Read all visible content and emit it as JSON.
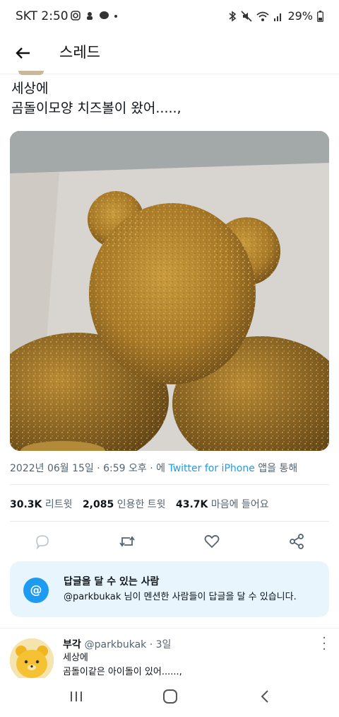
{
  "status_bar": {
    "carrier_time": "SKT 2:50",
    "battery": "29%"
  },
  "app_bar": {
    "title": "스레드"
  },
  "tweet": {
    "text_line1": "세상에",
    "text_line2": "곰돌이모양 치즈볼이 왔어.....,",
    "meta_datetime": "2022년 06월 15일 · 6:59 오후 · 에 ",
    "meta_source": "Twitter for iPhone",
    "meta_suffix": " 앱을 통해",
    "stats": {
      "retweets_value": "30.3K",
      "retweets_label": "리트윗",
      "quotes_value": "2,085",
      "quotes_label": "인용한 트윗",
      "likes_value": "43.7K",
      "likes_label": "마음에 들어요"
    }
  },
  "reply_restriction": {
    "badge": "@",
    "title": "답글을 달 수 있는 사람",
    "description": "@parkbukak 님이 멘션한 사람들이 답글을 달 수 있습니다."
  },
  "reply": {
    "name": "부각",
    "handle_time": "@parkbukak · 3일",
    "line1": "세상에",
    "line2": "곰돌이같은 아이돌이 있어......,"
  },
  "colors": {
    "accent": "#1d9bf0",
    "notice_bg": "#e8f5fd",
    "secondary_text": "#536471"
  },
  "icons": [
    "back-arrow-icon",
    "reply-icon",
    "retweet-icon",
    "like-icon",
    "share-icon",
    "recent-apps-icon",
    "home-icon",
    "nav-back-icon"
  ]
}
